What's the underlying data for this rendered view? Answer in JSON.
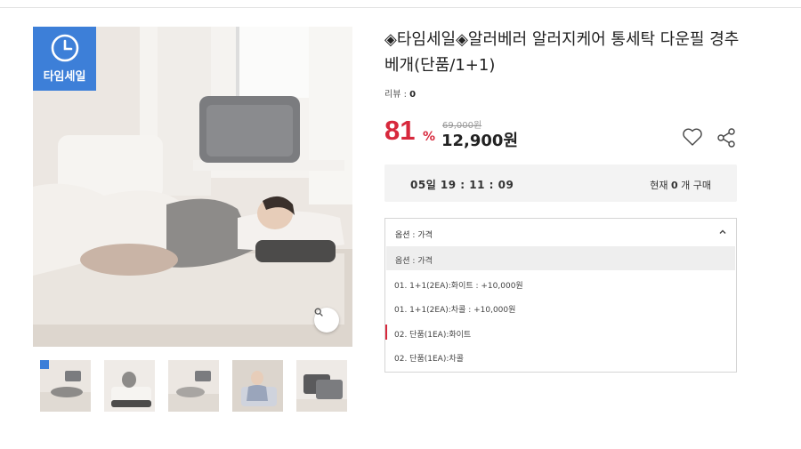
{
  "product": {
    "title": "◈타임세일◈알러베러 알러지케어 통세탁 다운필 경추 베개(단품/1+1)",
    "review_label": "리뷰 : ",
    "review_count": "0",
    "discount_rate": "81",
    "discount_unit": "%",
    "original_price": "69,000원",
    "sale_price": "12,900원"
  },
  "badge": {
    "label": "타임세일",
    "icon": "clock-icon",
    "color": "#3d7fd8"
  },
  "timer": {
    "text": "05일   19 : 11 : 09",
    "buy_prefix": "현재 ",
    "buy_count": "0",
    "buy_suffix": " 개 구매"
  },
  "options": {
    "header": "옵션 : 가격",
    "items": [
      "옵션 : 가격",
      "01. 1+1(2EA):화이트 : +10,000원",
      "01. 1+1(2EA):차콜 : +10,000원",
      "02. 단품(1EA):화이트",
      "02. 단품(1EA):차콜"
    ]
  },
  "icons": {
    "heart": "heart-icon",
    "share": "share-icon",
    "zoom": "search-icon",
    "chevron": "chevron-up-icon"
  },
  "colors": {
    "accent_red": "#d7283c",
    "badge_blue": "#3d7fd8"
  }
}
